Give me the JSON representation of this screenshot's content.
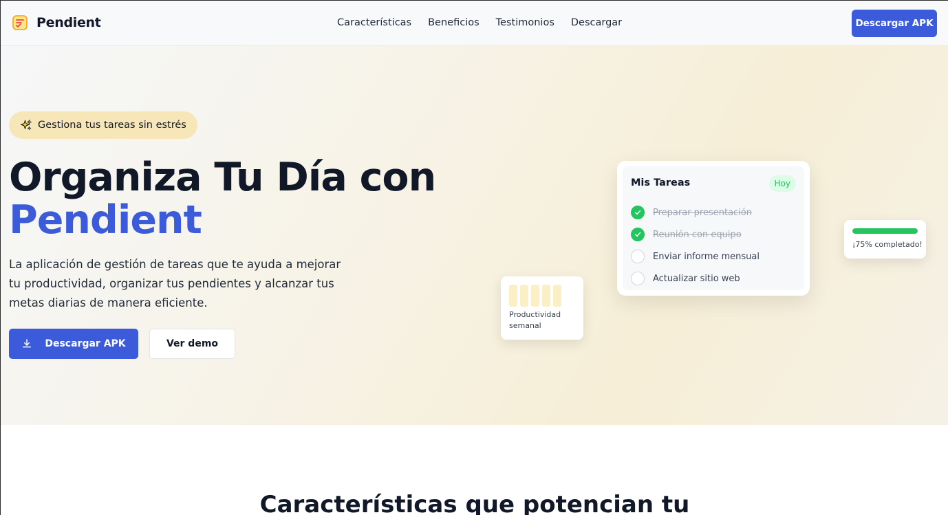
{
  "brand": {
    "name": "Pendient",
    "icon": "checklist-icon"
  },
  "nav": {
    "links": [
      "Características",
      "Beneficios",
      "Testimonios",
      "Descargar"
    ],
    "cta": "Descargar APK"
  },
  "hero": {
    "badge": {
      "icon": "sparkles-icon",
      "text": "Gestiona tus tareas sin estrés"
    },
    "title_line1": "Organiza Tu Día con",
    "title_accent": "Pendient",
    "description": "La aplicación de gestión de tareas que te ayuda a mejorar tu productividad, organizar tus pendientes y alcanzar tus metas diarias de manera eficiente.",
    "primary_button": {
      "label": "Descargar APK",
      "icon": "download-icon"
    },
    "secondary_button": {
      "label": "Ver demo"
    }
  },
  "task_card": {
    "title": "Mis Tareas",
    "chip": "Hoy",
    "tasks": [
      {
        "label": "Preparar presentación",
        "done": true
      },
      {
        "label": "Reunión con equipo",
        "done": true
      },
      {
        "label": "Enviar informe mensual",
        "done": false
      },
      {
        "label": "Actualizar sitio web",
        "done": false
      }
    ]
  },
  "progress_card": {
    "percent": 100,
    "text": "¡75% completado!"
  },
  "productivity_card": {
    "bar_count": 5,
    "label": "Productividad semanal"
  },
  "features": {
    "title": "Características que potencian tu"
  },
  "colors": {
    "primary": "#3b5bdb",
    "success": "#22c55e",
    "badge_bg": "#f6e6b8"
  }
}
